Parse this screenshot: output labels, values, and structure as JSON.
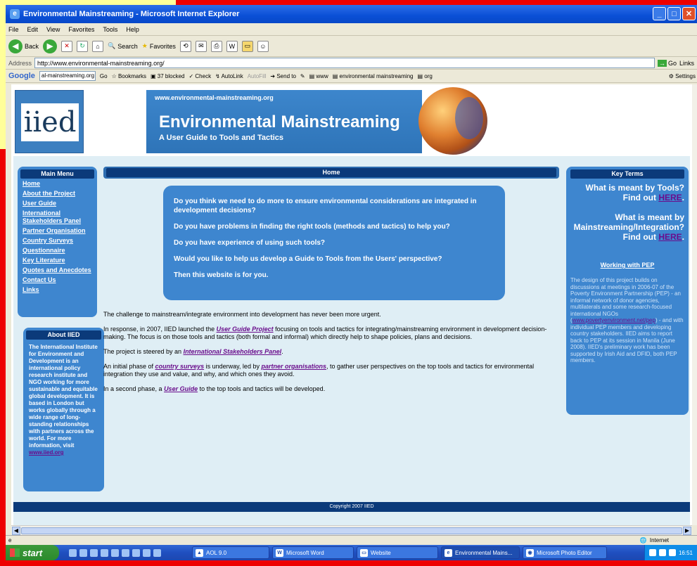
{
  "window": {
    "title": "Environmental Mainstreaming - Microsoft Internet Explorer"
  },
  "menubar": [
    "File",
    "Edit",
    "View",
    "Favorites",
    "Tools",
    "Help"
  ],
  "toolbar": {
    "back": "Back",
    "search": "Search",
    "favorites": "Favorites"
  },
  "address": {
    "label": "Address",
    "url": "http://www.environmental-mainstreaming.org/",
    "go": "Go",
    "links": "Links"
  },
  "google": {
    "logo": "Google",
    "query": "al-mainstreaming.org",
    "go": "Go",
    "bookmarks": "Bookmarks",
    "blocked": "37 blocked",
    "check": "Check",
    "autolink": "AutoLink",
    "autofill": "AutoFill",
    "sendto": "Send to",
    "www": "www",
    "term1": "environmental mainstreaming",
    "term2": "org",
    "settings": "Settings"
  },
  "banner": {
    "logo": "iied",
    "url": "www.environmental-mainstreaming.org",
    "title": "Environmental Mainstreaming",
    "subtitle": "A User Guide to Tools and Tactics"
  },
  "main_menu": {
    "heading": "Main Menu",
    "items": [
      "Home",
      "About the Project",
      "User Guide",
      "International Stakeholders Panel",
      "Partner Organisation",
      "Country Surveys",
      "Questionnaire",
      "Key Literature",
      "Quotes and Anecdotes",
      "Contact Us",
      "Links"
    ]
  },
  "about": {
    "heading": "About IIED",
    "body": "The International Institute for Environment and Development is an international policy research institute and NGO working for more sustainable and equitable global development. It is based in London but works globally through a wide range of long-standing relationships with partners across the world. For more information, visit",
    "link": "www.iied.org"
  },
  "home": {
    "heading": "Home",
    "questions": [
      "Do you think we need to do more to ensure environmental considerations are integrated in development decisions?",
      "Do you have problems in finding the right tools (methods and tactics) to help you?",
      "Do you have experience of using such tools?",
      "Would you like to help us develop a Guide to Tools from the Users' perspective?",
      "Then this website is for you."
    ],
    "p1": "The challenge to mainstream/integrate environment into development has never been more urgent.",
    "p2a": "In response, in 2007, IIED launched the ",
    "p2link": "User Guide Project",
    "p2b": " focusing on tools and tactics for integrating/mainstreaming environment in development decision-making. The focus is on those tools and tactics (both formal and informal) which directly help to shape policies, plans and decisions.",
    "p3a": "The project is steered by an ",
    "p3link": "International Stakeholders Panel",
    "p3b": ".",
    "p4a": "An initial phase of ",
    "p4link1": "country surveys",
    "p4b": " is underway, led by ",
    "p4link2": "partner organisations",
    "p4c": ", to gather user perspectives on the top tools and tactics for environmental integration they use and value, and why, and which ones they avoid.",
    "p5a": "In a second phase, a ",
    "p5link": "User Guide",
    "p5b": " to the top tools and tactics will be developed."
  },
  "key_terms": {
    "heading": "Key Terms",
    "q1": "What is meant by Tools?",
    "q1b": "Find out ",
    "q1link": "HERE",
    "q2": "What is meant by Mainstreaming/Integration?",
    "q2b": "Find out ",
    "q2link": "HERE",
    "pep_heading": "Working with PEP",
    "pep_body1": "The design of this project builds on discussions at meetings in 2006-07 of the Poverty Environment Partnership (PEP) - an informal network of donor agencies, multilaterals and some research-focused international NGOs (",
    "pep_link": "www.povertyenvironment.net/pep",
    "pep_body2": ") - and with individual PEP members and developing country stakeholders. IIED aims to report back to PEP at its session in Manila (June 2008). IIED's preliminary work has been supported by Irish Aid and DFID, both PEP members."
  },
  "footer": "Copyright 2007 IIED",
  "status": {
    "zone": "Internet"
  },
  "taskbar": {
    "start": "start",
    "tasks": [
      "AOL 9.0",
      "Microsoft Word",
      "Website",
      "Environmental Mains...",
      "Microsoft Photo Editor"
    ],
    "clock": "16:51"
  }
}
